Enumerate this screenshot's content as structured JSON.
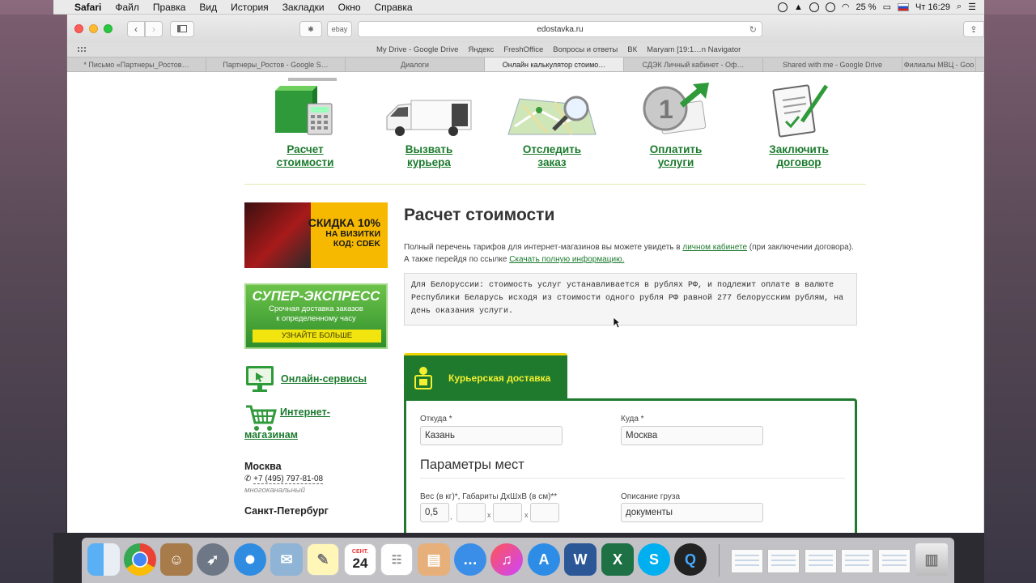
{
  "menubar": {
    "app": "Safari",
    "items": [
      "Файл",
      "Правка",
      "Вид",
      "История",
      "Закладки",
      "Окно",
      "Справка"
    ],
    "battery": "25 %",
    "clock": "Чт 16:29"
  },
  "browser": {
    "url": "edostavka.ru",
    "favorites": [
      "My Drive - Google Drive",
      "Яндекс",
      "FreshOffice",
      "Вопросы и ответы",
      "ВК",
      "Maryam [19:1…n Navigator"
    ],
    "tabs": [
      "* Письмо «Партнеры_Ростов…",
      "Партнеры_Ростов - Google S…",
      "Диалоги",
      "Онлайн калькулятор стоимо…",
      "СДЭК Личный кабинет - Оф…",
      "Shared with me - Google Drive",
      "Филиалы МВЦ - Goo"
    ],
    "active_tab": 3,
    "search_btn": "ebay"
  },
  "topnav": [
    {
      "line1": "Расчет",
      "line2": "стоимости"
    },
    {
      "line1": "Вызвать",
      "line2": "курьера"
    },
    {
      "line1": "Отследить",
      "line2": "заказ"
    },
    {
      "line1": "Оплатить",
      "line2": "услуги"
    },
    {
      "line1": "Заключить",
      "line2": "договор"
    }
  ],
  "sidebar": {
    "promo1": {
      "line1": "СКИДКА 10%",
      "line2": "НА ВИЗИТКИ",
      "line3": "КОД: CDEK"
    },
    "promo2": {
      "title": "СУПЕР-ЭКСПРЕСС",
      "line1": "Срочная доставка заказов",
      "line2": "к определенному часу",
      "button": "УЗНАЙТЕ БОЛЬШЕ"
    },
    "online_services": "Онлайн-сервисы",
    "shops_line1": "Интернет-",
    "shops_line2": "магазинам",
    "city1": "Москва",
    "phone1": "+7 (495) 797-81-08",
    "phone_note": "многоканальный",
    "city2": "Санкт-Петербург"
  },
  "main": {
    "title": "Расчет стоимости",
    "intro_1": "Полный перечень тарифов для интернет-магазинов вы можете увидеть в ",
    "intro_link1": "личном кабинете",
    "intro_2": " (при заключении договора). А также перейдя по ссылке ",
    "intro_link2": "Скачать полную информацию.",
    "notice": "Для Белоруссии: стоимость услуг устанавливается в рублях РФ, и подлежит оплате в валюте Республики Беларусь исходя из стоимости одного рубля РФ равной 277 белорусским рублям, на день оказания услуги."
  },
  "form": {
    "tab_label": "Курьерская доставка",
    "from_label": "Откуда *",
    "from_value": "Казань",
    "to_label": "Куда *",
    "to_value": "Москва",
    "section": "Параметры мест",
    "weight_label": "Вес (в кг)*, Габариты ДхШхВ (в см)**",
    "weight_value": "0,5",
    "desc_label": "Описание груза",
    "desc_value": "документы"
  },
  "dock": {
    "calendar_month": "СЕНТ.",
    "calendar_day": "24"
  }
}
